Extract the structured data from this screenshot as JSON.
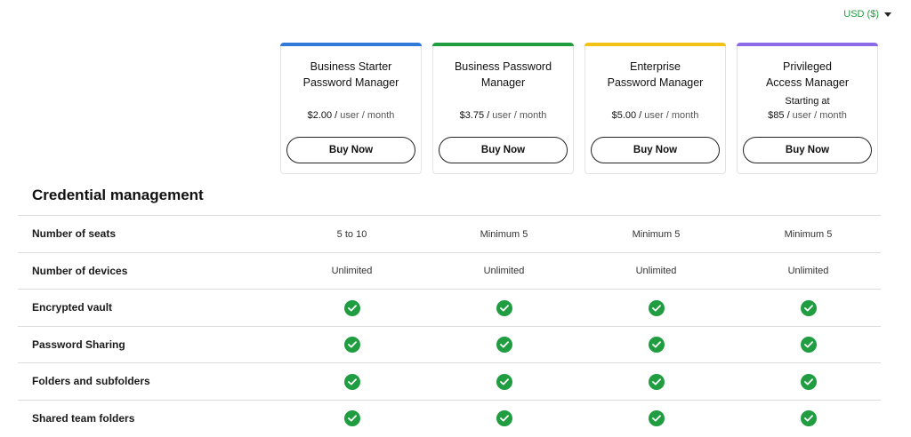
{
  "currency": {
    "label": "USD ($)"
  },
  "colors": {
    "accent_green": "#1e9c3e",
    "check_green": "#1f9d40",
    "plan_bars": [
      "#2f7ad9",
      "#1f9d40",
      "#f2c316",
      "#8b6be8"
    ]
  },
  "plans": [
    {
      "name": "Business Starter\nPassword Manager",
      "starting": "",
      "amount": "$2.00 /",
      "unit": " user / month",
      "button": "Buy Now"
    },
    {
      "name": "Business Password\nManager",
      "starting": "",
      "amount": "$3.75 /",
      "unit": " user / month",
      "button": "Buy Now"
    },
    {
      "name": "Enterprise\nPassword Manager",
      "starting": "",
      "amount": "$5.00 /",
      "unit": " user / month",
      "button": "Buy Now"
    },
    {
      "name": "Privileged\nAccess Manager",
      "starting": "Starting at",
      "amount": "$85 /",
      "unit": " user / month",
      "button": "Buy Now"
    }
  ],
  "section": {
    "title": "Credential management"
  },
  "features": [
    {
      "label": "Number of seats",
      "values": [
        "5 to 10",
        "Minimum 5",
        "Minimum 5",
        "Minimum 5"
      ]
    },
    {
      "label": "Number of devices",
      "values": [
        "Unlimited",
        "Unlimited",
        "Unlimited",
        "Unlimited"
      ]
    },
    {
      "label": "Encrypted vault",
      "values": [
        "check",
        "check",
        "check",
        "check"
      ]
    },
    {
      "label": "Password Sharing",
      "values": [
        "check",
        "check",
        "check",
        "check"
      ]
    },
    {
      "label": "Folders and subfolders",
      "values": [
        "check",
        "check",
        "check",
        "check"
      ]
    },
    {
      "label": "Shared team folders",
      "values": [
        "check",
        "check",
        "check",
        "check"
      ]
    }
  ],
  "icons": {
    "included": "check-circle-icon",
    "dropdown": "caret-down-icon"
  }
}
